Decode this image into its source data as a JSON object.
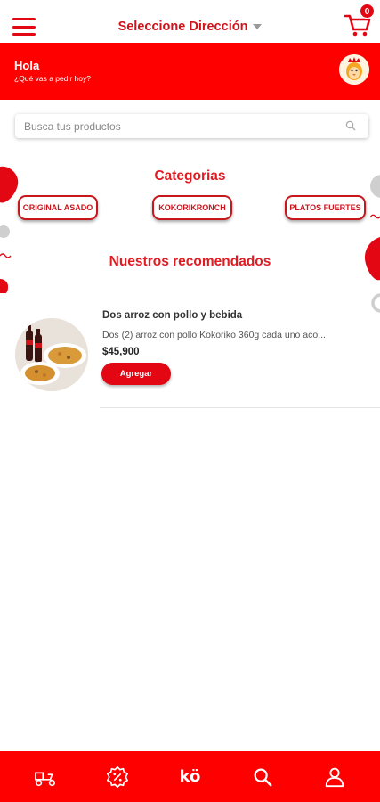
{
  "header": {
    "address_label": "Seleccione Dirección",
    "cart_count": "0"
  },
  "banner": {
    "greeting": "Hola",
    "subtitle": "¿Qué vas a pedir hoy?"
  },
  "search": {
    "placeholder": "Busca tus productos"
  },
  "categories": {
    "title": "Categorias",
    "items": [
      {
        "label": "ORIGINAL ASADO"
      },
      {
        "label": "KOKORIKRONCH"
      },
      {
        "label": "PLATOS FUERTES"
      }
    ]
  },
  "recommended": {
    "title": "Nuestros recomendados",
    "products": [
      {
        "name": "Dos arroz con pollo y bebida",
        "description": "Dos (2) arroz con pollo Kokoriko 360g cada uno aco...",
        "price": "$45,900",
        "button_label": "Agregar"
      }
    ]
  },
  "bottom_nav": {
    "logo_text": "kö",
    "items": [
      {
        "icon": "delivery-scooter-icon"
      },
      {
        "icon": "discount-badge-icon"
      },
      {
        "icon": "brand-logo-icon"
      },
      {
        "icon": "search-icon"
      },
      {
        "icon": "profile-icon"
      }
    ]
  },
  "colors": {
    "brand_red": "#ff0000",
    "text_red": "#e01b22"
  }
}
